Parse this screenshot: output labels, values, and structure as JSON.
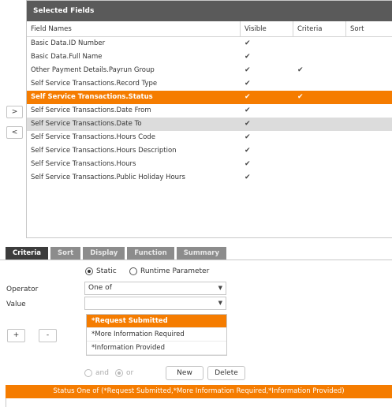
{
  "selected_fields": {
    "title": "Selected Fields",
    "columns": {
      "name": "Field Names",
      "visible": "Visible",
      "criteria": "Criteria",
      "sort": "Sort"
    },
    "rows": [
      {
        "name": "Basic Data.ID Number",
        "visible": "✔",
        "criteria": ""
      },
      {
        "name": "Basic Data.Full Name",
        "visible": "✔",
        "criteria": ""
      },
      {
        "name": "Other Payment Details.Payrun Group",
        "visible": "✔",
        "criteria": "✔"
      },
      {
        "name": "Self Service Transactions.Record Type",
        "visible": "✔",
        "criteria": ""
      },
      {
        "name": "Self Service Transactions.Status",
        "visible": "✔",
        "criteria": "✔"
      },
      {
        "name": "Self Service Transactions.Date From",
        "visible": "✔",
        "criteria": ""
      },
      {
        "name": "Self Service Transactions.Date To",
        "visible": "✔",
        "criteria": ""
      },
      {
        "name": "Self Service Transactions.Hours Code",
        "visible": "✔",
        "criteria": ""
      },
      {
        "name": "Self Service Transactions.Hours Description",
        "visible": "✔",
        "criteria": ""
      },
      {
        "name": "Self Service Transactions.Hours",
        "visible": "✔",
        "criteria": ""
      },
      {
        "name": "Self Service Transactions.Public Holiday Hours",
        "visible": "✔",
        "criteria": ""
      }
    ]
  },
  "move_buttons": {
    "add": ">",
    "remove": "<"
  },
  "tabs": [
    "Criteria",
    "Sort",
    "Display",
    "Function",
    "Summary"
  ],
  "criteria": {
    "mode_static": "Static",
    "mode_runtime": "Runtime Parameter",
    "operator_label": "Operator",
    "operator_value": "One of",
    "value_label": "Value",
    "value_value": "",
    "plus_label": "+",
    "minus_label": "-",
    "values": [
      "*Request Submitted",
      "*More Information Required",
      "*Information Provided"
    ],
    "and_label": "and",
    "or_label": "or",
    "new_label": "New",
    "delete_label": "Delete",
    "summary": "Status One of (*Request Submitted,*More Information Required,*Information Provided)"
  }
}
